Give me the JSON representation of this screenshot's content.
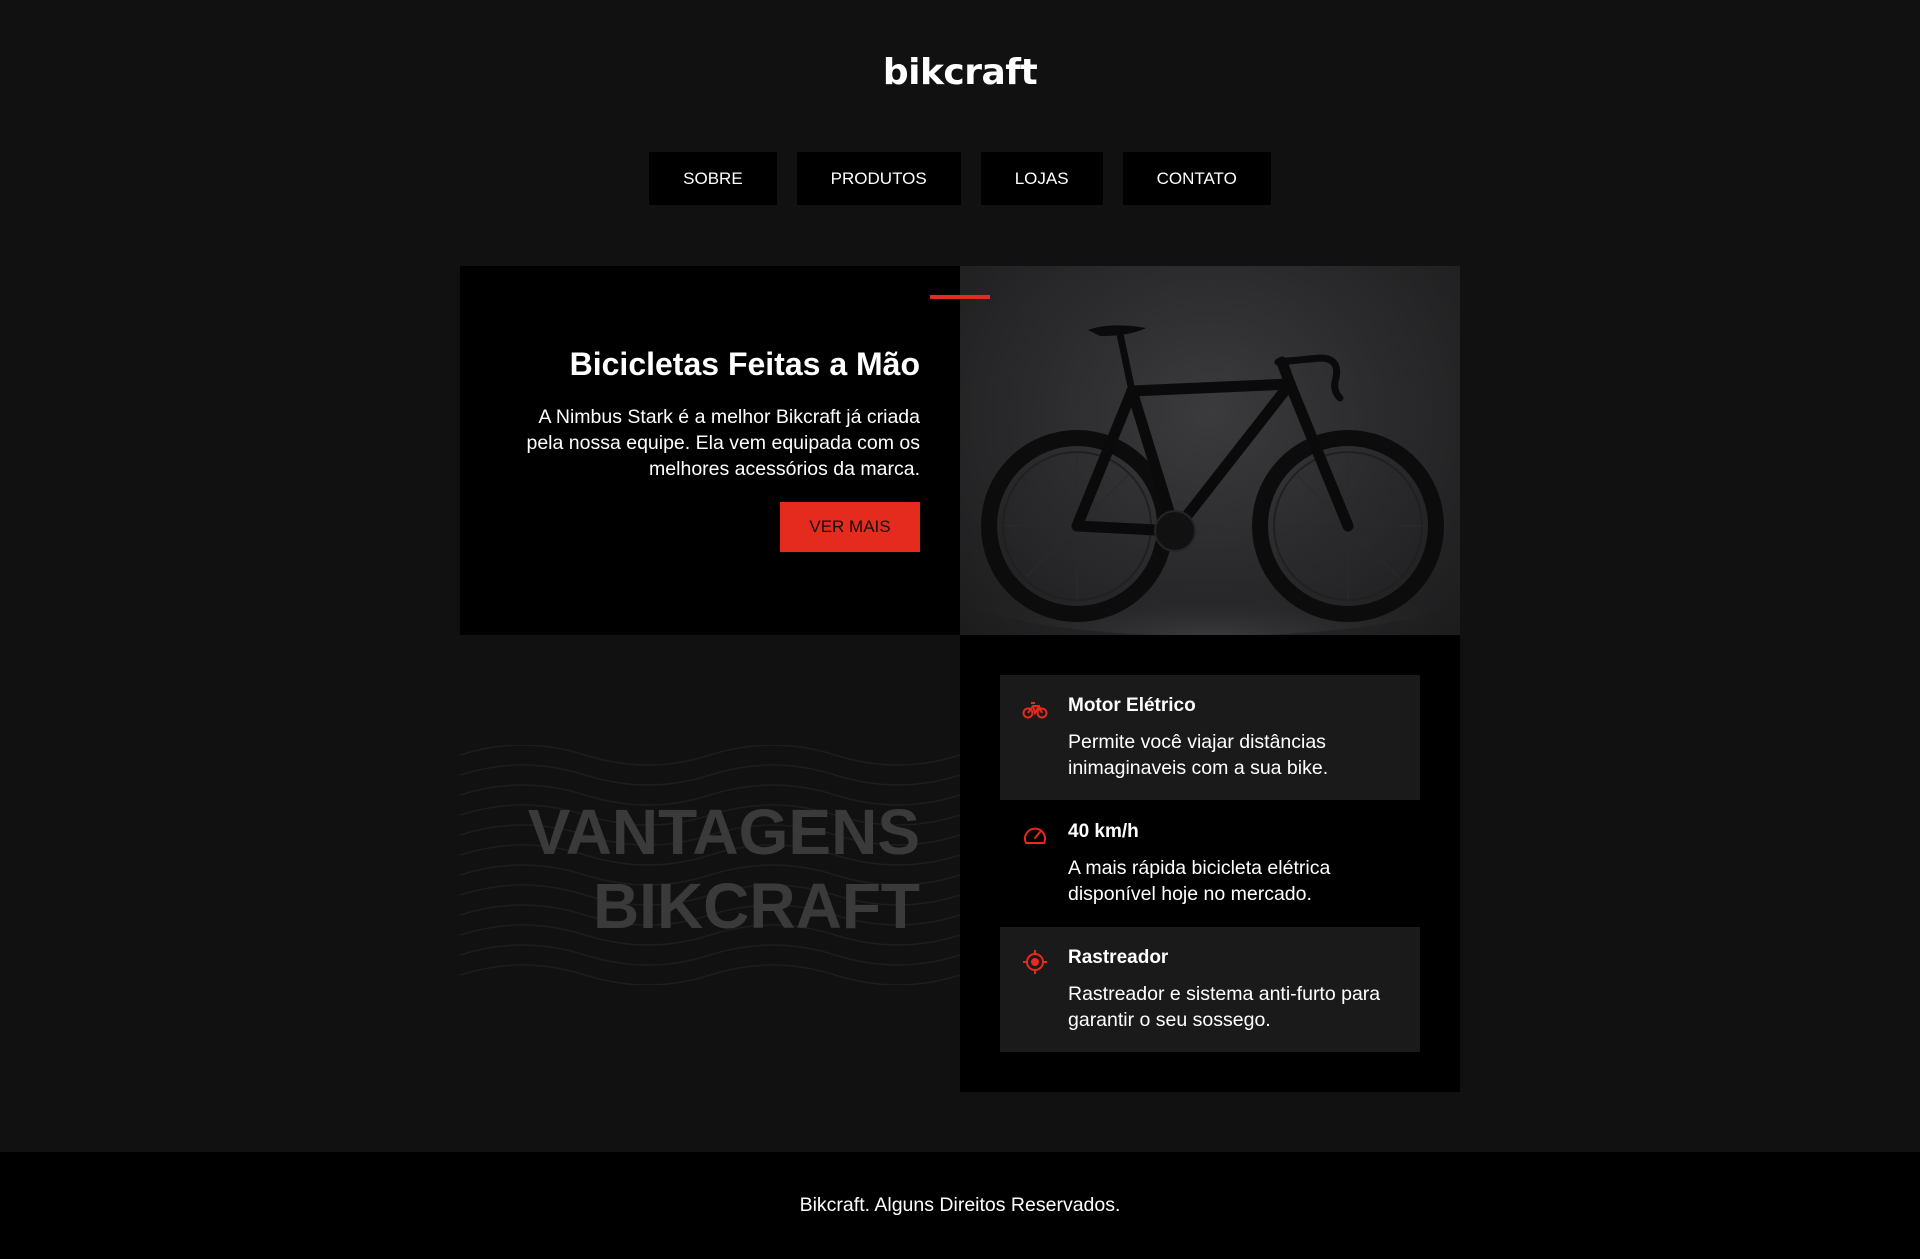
{
  "header": {
    "logo": "bikcraft"
  },
  "nav": {
    "items": [
      {
        "label": "SOBRE"
      },
      {
        "label": "PRODUTOS"
      },
      {
        "label": "LOJAS"
      },
      {
        "label": "CONTATO"
      }
    ]
  },
  "hero": {
    "title": "Bicicletas Feitas a Mão",
    "text": "A Nimbus Stark é a melhor Bikcraft já criada pela nossa equipe. Ela vem equipada com os melhores acessórios da marca.",
    "button_label": "VER MAIS",
    "image_icon": "bicycle-photo"
  },
  "vantagens": {
    "line1": "VANTAGENS",
    "line2": "BIKCRAFT"
  },
  "features": [
    {
      "icon": "bike-motor-icon",
      "title": "Motor Elétrico",
      "text": "Permite você viajar distâncias inimaginaveis com a sua bike."
    },
    {
      "icon": "speedometer-icon",
      "title": "40 km/h",
      "text": "A mais rápida bicicleta elétrica disponível hoje no mercado."
    },
    {
      "icon": "target-icon",
      "title": "Rastreador",
      "text": "Rastreador e sistema anti-furto para garantir o seu sossego."
    }
  ],
  "footer": {
    "text": "Bikcraft. Alguns Direitos Reservados."
  },
  "colors": {
    "background": "#111111",
    "panel": "#000000",
    "accent": "#e52a1e",
    "feature_shade": "#1a1a1a"
  }
}
